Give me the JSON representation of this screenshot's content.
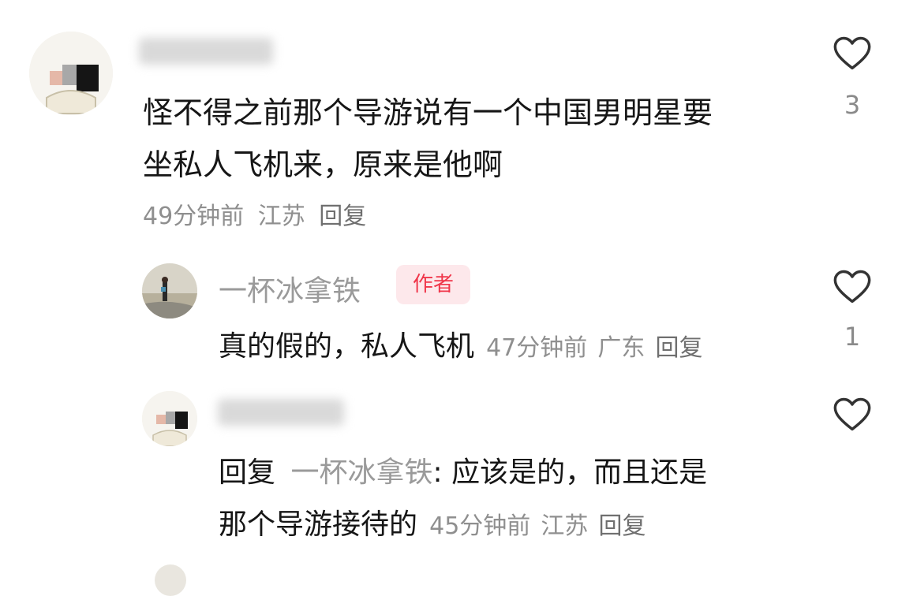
{
  "comments": [
    {
      "username": "",
      "text_lines": [
        "怪不得之前那个导游说有一个中国男明星要",
        "坐私人飞机来，原来是他啊"
      ],
      "time": "49分钟前",
      "location": "江苏",
      "reply_label": "回复",
      "likes": "3"
    },
    {
      "username": "一杯冰拿铁",
      "badge": "作者",
      "text": "真的假的，私人飞机",
      "time": "47分钟前",
      "location": "广东",
      "reply_label": "回复",
      "likes": "1"
    },
    {
      "username": "",
      "reply_prefix": "回复",
      "reply_to": "一杯冰拿铁",
      "reply_colon": ":",
      "text_line1": "应该是的，而且还是",
      "text_line2": "那个导游接待的",
      "time": "45分钟前",
      "location": "江苏",
      "reply_label": "回复",
      "likes": ""
    }
  ],
  "icons": {
    "like": "heart-outline-icon"
  },
  "colors": {
    "author_badge_bg": "#fde8eb",
    "author_badge_text": "#f0364a"
  }
}
